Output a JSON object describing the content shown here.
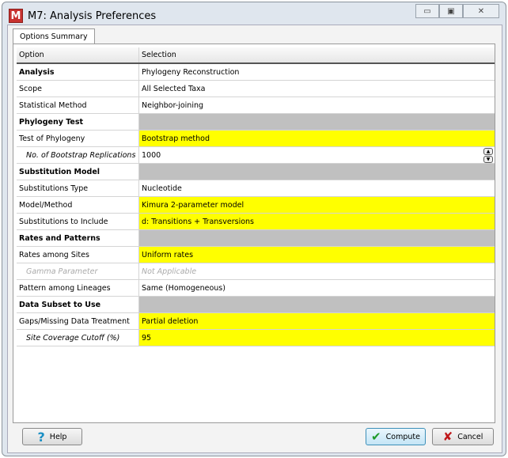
{
  "window": {
    "title": "M7: Analysis Preferences",
    "logo": "M"
  },
  "tab": "Options Summary",
  "columns": [
    "Option",
    "Selection"
  ],
  "rows": [
    {
      "option": "Analysis",
      "selection": "Phylogeny Reconstruction",
      "style": "bold"
    },
    {
      "option": "Scope",
      "selection": "All Selected Taxa"
    },
    {
      "option": "Statistical Method",
      "selection": "Neighbor-joining"
    },
    {
      "option": "Phylogeny Test",
      "selection": "",
      "style": "section"
    },
    {
      "option": "Test of Phylogeny",
      "selection": "Bootstrap method",
      "highlight": true
    },
    {
      "option": "No. of Bootstrap Replications",
      "selection": "1000",
      "style": "sub",
      "spinner": true
    },
    {
      "option": "Substitution Model",
      "selection": "",
      "style": "section"
    },
    {
      "option": "Substitutions Type",
      "selection": "Nucleotide"
    },
    {
      "option": "Model/Method",
      "selection": "Kimura 2-parameter model",
      "highlight": true
    },
    {
      "option": "Substitutions to Include",
      "selection": "d: Transitions + Transversions",
      "highlight": true
    },
    {
      "option": "Rates and Patterns",
      "selection": "",
      "style": "section"
    },
    {
      "option": "Rates among Sites",
      "selection": "Uniform rates",
      "highlight": true
    },
    {
      "option": "Gamma Parameter",
      "selection": "Not Applicable",
      "style": "disabled"
    },
    {
      "option": "Pattern among Lineages",
      "selection": "Same (Homogeneous)"
    },
    {
      "option": "Data Subset to Use",
      "selection": "",
      "style": "section"
    },
    {
      "option": "Gaps/Missing Data Treatment",
      "selection": "Partial deletion",
      "highlight": true
    },
    {
      "option": "Site Coverage Cutoff (%)",
      "selection": "95",
      "style": "sub",
      "highlight": true
    }
  ],
  "buttons": {
    "help": "Help",
    "compute": "Compute",
    "cancel": "Cancel"
  },
  "colors": {
    "highlight": "#ffff00",
    "section": "#c0c0c0"
  }
}
